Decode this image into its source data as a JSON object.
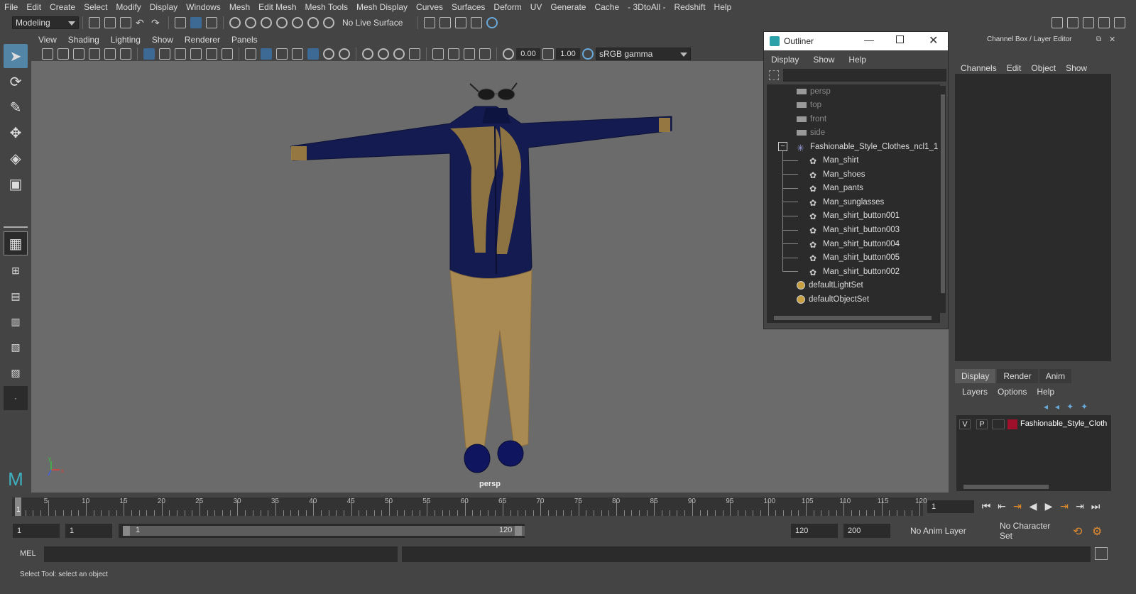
{
  "menubar": [
    "File",
    "Edit",
    "Create",
    "Select",
    "Modify",
    "Display",
    "Windows",
    "Mesh",
    "Edit Mesh",
    "Mesh Tools",
    "Mesh Display",
    "Curves",
    "Surfaces",
    "Deform",
    "UV",
    "Generate",
    "Cache",
    "- 3DtoAll -",
    "Redshift",
    "Help"
  ],
  "shelf": {
    "mode": "Modeling",
    "live_surface": "No Live Surface"
  },
  "viewport": {
    "menu": [
      "View",
      "Shading",
      "Lighting",
      "Show",
      "Renderer",
      "Panels"
    ],
    "exposure": "0.00",
    "gamma": "1.00",
    "color_space": "sRGB gamma",
    "camera_label": "persp"
  },
  "outliner": {
    "title": "Outliner",
    "menu": [
      "Display",
      "Show",
      "Help"
    ],
    "items": [
      {
        "label": "persp",
        "dim": true
      },
      {
        "label": "top",
        "dim": true
      },
      {
        "label": "front",
        "dim": true
      },
      {
        "label": "side",
        "dim": true
      },
      {
        "label": "Fashionable_Style_Clothes_ncl1_1"
      },
      {
        "label": "Man_shirt"
      },
      {
        "label": "Man_shoes"
      },
      {
        "label": "Man_pants"
      },
      {
        "label": "Man_sunglasses"
      },
      {
        "label": "Man_shirt_button001"
      },
      {
        "label": "Man_shirt_button003"
      },
      {
        "label": "Man_shirt_button004"
      },
      {
        "label": "Man_shirt_button005"
      },
      {
        "label": "Man_shirt_button002"
      },
      {
        "label": "defaultLightSet"
      },
      {
        "label": "defaultObjectSet"
      }
    ]
  },
  "channel_box": {
    "title": "Channel Box / Layer Editor",
    "menu": [
      "Channels",
      "Edit",
      "Object",
      "Show"
    ],
    "tabs": [
      "Display",
      "Render",
      "Anim"
    ],
    "layer_menu": [
      "Layers",
      "Options",
      "Help"
    ],
    "layer": {
      "v": "V",
      "p": "P",
      "name": "Fashionable_Style_Cloth",
      "color": "#a0102a"
    }
  },
  "timeline": {
    "ticks": [
      "5",
      "10",
      "15",
      "20",
      "25",
      "30",
      "35",
      "40",
      "45",
      "50",
      "55",
      "60",
      "65",
      "70",
      "75",
      "80",
      "85",
      "90",
      "95",
      "100",
      "105",
      "110",
      "115",
      "120"
    ],
    "current_frame": "1",
    "start_marker": "1"
  },
  "range": {
    "start": "1",
    "playback_start": "1",
    "slider_start": "1",
    "slider_end": "120",
    "playback_end": "120",
    "end": "200",
    "anim_layer": "No Anim Layer",
    "char_set": "No Character Set"
  },
  "command": {
    "lang": "MEL"
  },
  "status": "Select Tool: select an object"
}
